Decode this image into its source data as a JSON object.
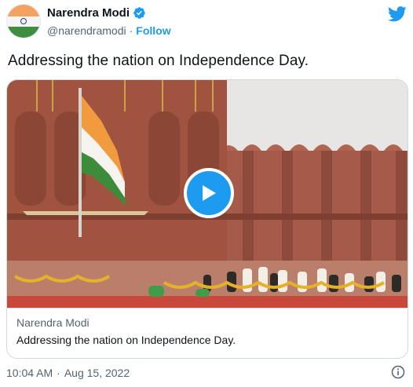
{
  "author": {
    "name": "Narendra Modi",
    "handle": "@narendramodi",
    "separator": "·",
    "follow_label": "Follow",
    "verified": true
  },
  "tweet": {
    "text": "Addressing the nation on Independence Day."
  },
  "media_card": {
    "type": "video",
    "source": "Narendra Modi",
    "title": "Addressing the nation on Independence Day."
  },
  "footer": {
    "time": "10:04 AM",
    "separator": "·",
    "date": "Aug 15, 2022"
  },
  "colors": {
    "accent": "#1d9bf0",
    "text": "#0f1419",
    "muted": "#536471",
    "border": "#cfd9de"
  },
  "icons": {
    "verified": "verified-badge-icon",
    "brand": "twitter-bird-icon",
    "play": "play-icon",
    "info": "info-icon"
  }
}
